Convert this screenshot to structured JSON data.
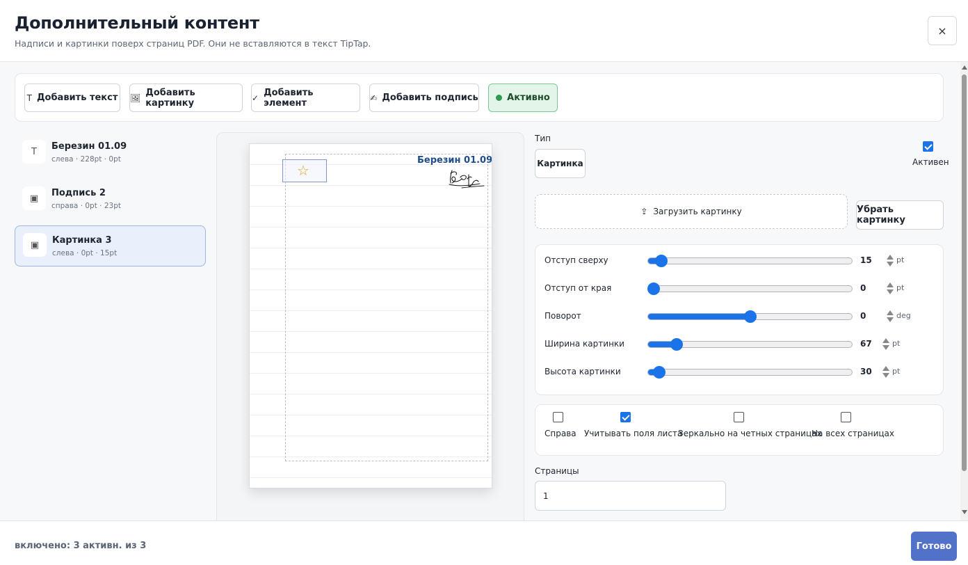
{
  "header": {
    "title": "Дополнительный контент",
    "subtitle": "Надписи и картинки поверх страниц PDF. Они не вставляются в текст TipTap.",
    "close_icon": "×"
  },
  "toolbar": {
    "add_text": {
      "icon": "T",
      "label": "Добавить текст"
    },
    "add_image": {
      "icon": "🖼",
      "label": "Добавить картинку"
    },
    "add_element": {
      "icon": "✓",
      "label": "Добавить элемент"
    },
    "add_signature": {
      "icon": "✍",
      "label": "Добавить подпись"
    },
    "active": {
      "label": "Активно",
      "color": "#2e9a4f"
    }
  },
  "items": [
    {
      "icon": "T",
      "title": "Березин 01.09",
      "sub": "слева · 228pt · 0pt"
    },
    {
      "icon": "▣",
      "title": "Подпись 2",
      "sub": "справа · 0pt · 23pt"
    },
    {
      "icon": "▣",
      "title": "Картинка 3",
      "sub": "слева · 0pt · 15pt"
    }
  ],
  "preview": {
    "page_text": "Березин 01.09",
    "star_glyph": "☆"
  },
  "props": {
    "type_label": "Тип",
    "type_value": "Картинка",
    "active_label": "Активен",
    "active_checked": true,
    "upload_icon": "⇪",
    "upload_label": "Загрузить картинку",
    "remove_label": "Убрать картинку",
    "sliders": [
      {
        "label": "Отступ сверху",
        "value": "15",
        "unit": "pt",
        "fraction": 0.04
      },
      {
        "label": "Отступ от края",
        "value": "0",
        "unit": "pt",
        "fraction": 0.0
      },
      {
        "label": "Поворот",
        "value": "0",
        "unit": "deg",
        "fraction": 0.5
      },
      {
        "label": "Ширина картинки",
        "value": "67",
        "unit": "pt",
        "fraction": 0.12
      },
      {
        "label": "Высота картинки",
        "value": "30",
        "unit": "pt",
        "fraction": 0.03
      }
    ],
    "options": [
      {
        "label": "Справа",
        "checked": false
      },
      {
        "label": "Учитывать поля листа",
        "checked": true
      },
      {
        "label": "Зеркально на четных страницах",
        "checked": false
      },
      {
        "label": "На всех страницах",
        "checked": false
      }
    ],
    "pages_label": "Страницы",
    "pages_value": "1"
  },
  "footer": {
    "status": "включено: 3 активн. из 3",
    "done_label": "Готово"
  },
  "colors": {
    "accent": "#1a73e8",
    "primary_button": "#5272c9"
  }
}
